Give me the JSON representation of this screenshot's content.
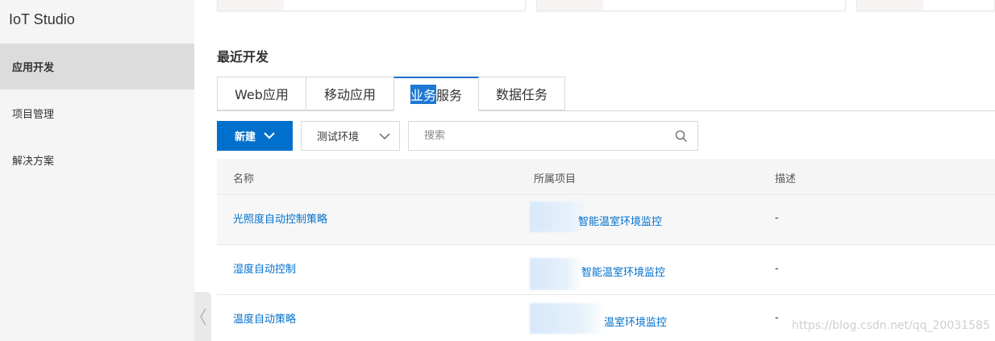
{
  "sidebar": {
    "title": "IoT Studio",
    "items": [
      {
        "label": "应用开发",
        "active": true
      },
      {
        "label": "项目管理",
        "active": false
      },
      {
        "label": "解决方案",
        "active": false
      }
    ],
    "collapse_icon": "chevron-left-icon"
  },
  "main": {
    "section_title": "最近开发",
    "tabs": [
      {
        "label": "Web应用"
      },
      {
        "label": "移动应用"
      },
      {
        "label_highlighted": "业务",
        "label_rest": "服务",
        "active": true
      },
      {
        "label": "数据任务"
      }
    ],
    "toolbar": {
      "new_label": "新建",
      "env_value": "测试环境",
      "search_placeholder": "搜索"
    },
    "table": {
      "columns": [
        "名称",
        "所属项目",
        "描述"
      ],
      "rows": [
        {
          "name": "光照度自动控制策略",
          "project": "智能温室环境监控",
          "description": "-"
        },
        {
          "name": "湿度自动控制",
          "project": "智能温室环境监控",
          "description": "-"
        },
        {
          "name": "温度自动策略",
          "project": "温室环境监控",
          "description": "-"
        }
      ]
    }
  },
  "colors": {
    "primary": "#0070cc",
    "tab_active_border": "#1c71c9",
    "sidebar_bg": "#f5f5f5",
    "sidebar_active_bg": "#dcdcdc"
  },
  "watermark": "https://blog.csdn.net/qq_20031585"
}
